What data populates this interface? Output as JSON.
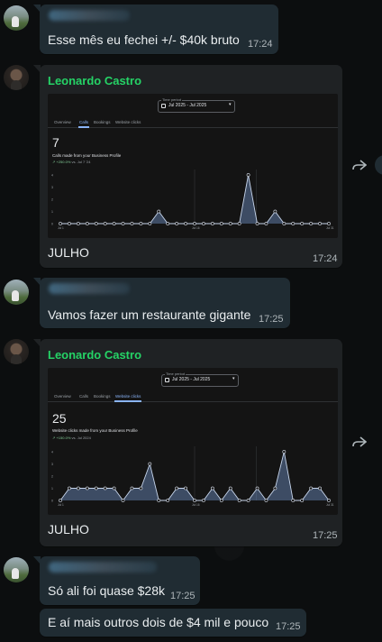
{
  "messages": [
    {
      "text": "Esse mês eu fechei +/- $40k bruto",
      "time": "17:24"
    },
    {
      "sender": "Leonardo Castro",
      "caption": "JULHO",
      "time": "17:24",
      "screenshot": {
        "period_label": "Time period",
        "period_value": "Jul 2025 - Jul 2025",
        "tabs": [
          "Overview",
          "Calls",
          "Bookings",
          "Website clicks"
        ],
        "active_tab": "Calls",
        "total": "7",
        "metric_label": "Calls made from your Business Profile",
        "delta": "+250.0%",
        "delta_note": "vs. Jul 7 '24"
      }
    },
    {
      "text": "Vamos fazer um restaurante gigante",
      "time": "17:25"
    },
    {
      "sender": "Leonardo Castro",
      "caption": "JULHO",
      "time": "17:25",
      "screenshot": {
        "period_label": "Time period",
        "period_value": "Jul 2025 - Jul 2025",
        "tabs": [
          "Overview",
          "Calls",
          "Bookings",
          "Website clicks"
        ],
        "active_tab": "Website clicks",
        "total": "25",
        "metric_label": "Website clicks made from your Business Profile",
        "delta": "+150.0%",
        "delta_note": "vs. Jul 2024"
      }
    },
    {
      "text": "Só ali foi quase $28k",
      "time": "17:25"
    },
    {
      "text": "E aí mais outros dois de $4 mil e pouco",
      "time": "17:25"
    }
  ],
  "chart_data": [
    {
      "type": "area",
      "title": "Calls made from your Business Profile",
      "x": [
        1,
        2,
        3,
        4,
        5,
        6,
        7,
        8,
        9,
        10,
        11,
        12,
        13,
        14,
        15,
        16,
        17,
        18,
        19,
        20,
        21,
        22,
        23,
        24,
        25,
        26,
        27,
        28,
        29,
        30,
        31
      ],
      "values": [
        0,
        0,
        0,
        0,
        0,
        0,
        0,
        0,
        0,
        0,
        0,
        1,
        0,
        0,
        0,
        0,
        0,
        0,
        0,
        0,
        0,
        4,
        0,
        0,
        1,
        0,
        0,
        0,
        0,
        0,
        0
      ],
      "ylim": [
        0,
        4
      ],
      "y_ticks": [
        0,
        1,
        2,
        3,
        4
      ],
      "x_ticks": [
        "Jul 1",
        "Jul 16",
        "Jul 31"
      ],
      "grid": false,
      "color": "#8ab4f8"
    },
    {
      "type": "area",
      "title": "Website clicks made from your Business Profile",
      "x": [
        1,
        2,
        3,
        4,
        5,
        6,
        7,
        8,
        9,
        10,
        11,
        12,
        13,
        14,
        15,
        16,
        17,
        18,
        19,
        20,
        21,
        22,
        23,
        24,
        25,
        26,
        27,
        28,
        29,
        30,
        31
      ],
      "values": [
        0,
        1,
        1,
        1,
        1,
        1,
        1,
        0,
        1,
        1,
        3,
        0,
        0,
        1,
        1,
        0,
        0,
        1,
        0,
        1,
        0,
        0,
        1,
        0,
        1,
        4,
        0,
        0,
        1,
        1,
        0
      ],
      "ylim": [
        0,
        4
      ],
      "y_ticks": [
        0,
        1,
        2,
        3,
        4
      ],
      "x_ticks": [
        "Jul 1",
        "Jul 16",
        "Jul 31"
      ],
      "grid": false,
      "color": "#8ab4f8"
    }
  ],
  "icons": {
    "forward": "forward-arrow-icon",
    "calendar": "calendar-icon",
    "dropdown": "dropdown-icon"
  }
}
